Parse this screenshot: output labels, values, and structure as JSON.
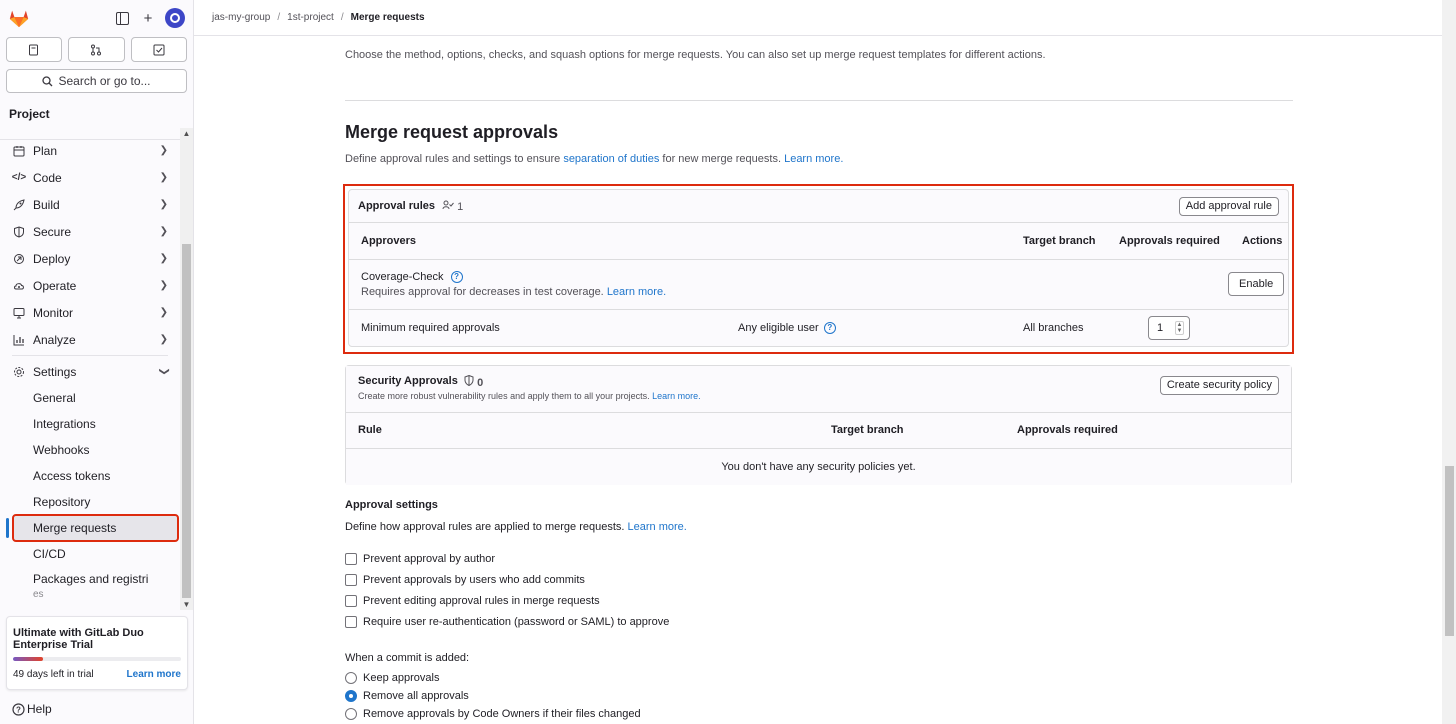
{
  "sidebar": {
    "search_label": "Search or go to...",
    "project_label": "Project",
    "nav": [
      {
        "label": "Plan",
        "icon": "plan-icon"
      },
      {
        "label": "Code",
        "icon": "code-icon"
      },
      {
        "label": "Build",
        "icon": "rocket-icon"
      },
      {
        "label": "Secure",
        "icon": "shield-icon"
      },
      {
        "label": "Deploy",
        "icon": "deploy-icon"
      },
      {
        "label": "Operate",
        "icon": "cloud-gear-icon"
      },
      {
        "label": "Monitor",
        "icon": "monitor-icon"
      },
      {
        "label": "Analyze",
        "icon": "chart-icon"
      },
      {
        "label": "Settings",
        "icon": "gear-icon"
      }
    ],
    "settings_sub": [
      "General",
      "Integrations",
      "Webhooks",
      "Access tokens",
      "Repository",
      "Merge requests",
      "CI/CD",
      "Packages and registri",
      "es"
    ],
    "trial": {
      "title": "Ultimate with GitLab Duo Enterprise Trial",
      "days_left": "49 days left in trial",
      "learn_more": "Learn more",
      "progress_fraction": 0.18
    },
    "help_label": "Help"
  },
  "breadcrumb": {
    "group": "jas-my-group",
    "project": "1st-project",
    "current": "Merge requests"
  },
  "main": {
    "intro": "Choose the method, options, checks, and squash options for merge requests. You can also set up merge request templates for different actions.",
    "approvals_title": "Merge request approvals",
    "approvals_desc_pre": "Define approval rules and settings to ensure",
    "approvals_desc_link": "separation of duties",
    "approvals_desc_post": "for new merge requests.",
    "learn_more": "Learn more.",
    "rules_card": {
      "title": "Approval rules",
      "count": "1",
      "add_button": "Add approval rule",
      "headers": {
        "approvers": "Approvers",
        "target_branch": "Target branch",
        "approvals_required": "Approvals required",
        "actions": "Actions"
      },
      "coverage": {
        "name": "Coverage-Check",
        "desc": "Requires approval for decreases in test coverage.",
        "learn_more": "Learn more.",
        "enable_button": "Enable"
      },
      "minimum": {
        "name": "Minimum required approvals",
        "approvers": "Any eligible user",
        "branch": "All branches",
        "value": "1"
      }
    },
    "security_card": {
      "title": "Security Approvals",
      "count": "0",
      "desc": "Create more robust vulnerability rules and apply them to all your projects.",
      "learn_more": "Learn more.",
      "button": "Create security policy",
      "headers": {
        "rule": "Rule",
        "target_branch": "Target branch",
        "approvals_required": "Approvals required"
      },
      "empty": "You don't have any security policies yet."
    },
    "approval_settings": {
      "title": "Approval settings",
      "desc": "Define how approval rules are applied to merge requests.",
      "learn_more": "Learn more.",
      "checkboxes": [
        "Prevent approval by author",
        "Prevent approvals by users who add commits",
        "Prevent editing approval rules in merge requests",
        "Require user re-authentication (password or SAML) to approve"
      ],
      "commit_label": "When a commit is added:",
      "radios": [
        "Keep approvals",
        "Remove all approvals",
        "Remove approvals by Code Owners if their files changed"
      ],
      "selected_radio": "Remove all approvals"
    }
  },
  "colors": {
    "accent": "#1f75cb",
    "highlight_border": "#dd2b0e",
    "brand": "#e24329"
  }
}
